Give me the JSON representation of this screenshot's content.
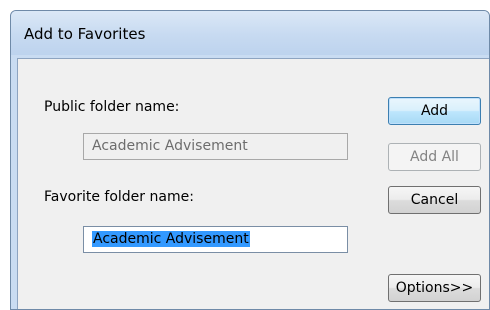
{
  "dialog": {
    "title": "Add to Favorites",
    "public_folder_label": "Public folder name:",
    "public_folder_value": "Academic Advisement",
    "favorite_folder_label": "Favorite folder name:",
    "favorite_folder_value": "Academic Advisement"
  },
  "buttons": {
    "add": "Add",
    "add_all": "Add All",
    "cancel": "Cancel",
    "options": "Options>>"
  }
}
